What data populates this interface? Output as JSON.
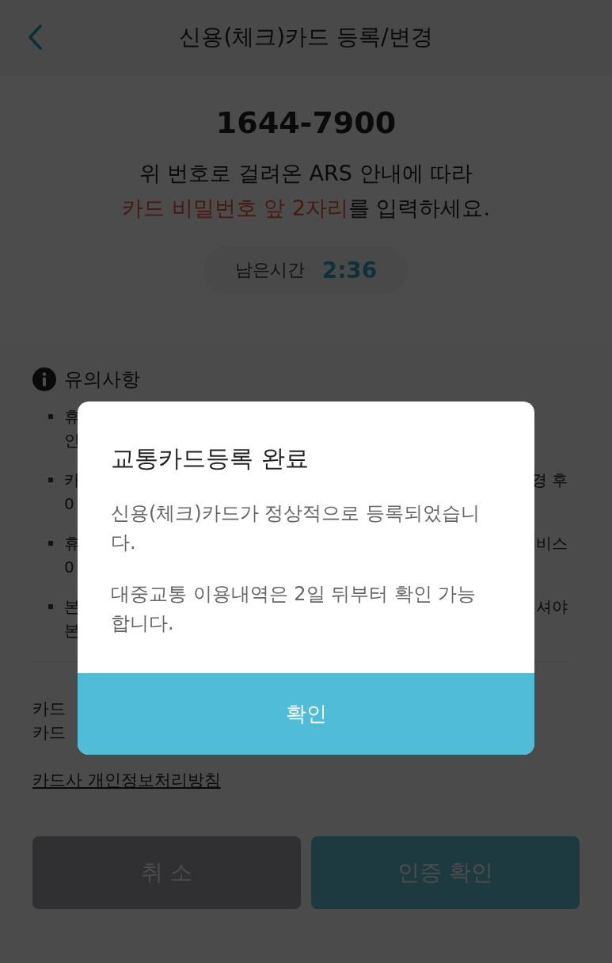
{
  "header": {
    "title": "신용(체크)카드 등록/변경"
  },
  "ars": {
    "phone": "1644-7900",
    "line_1": "위 번호로 걸려온 ARS 안내에 따라",
    "line_2": "**카드 비밀번호 앞 2자리**를 입력하세요.",
    "timer_label": "남은시간",
    "timer_value": "2:36"
  },
  "notes": {
    "heading": "유의사항",
    "items": [
      {
        "lines": [
          {
            "start": "휴"
          },
          {
            "start": "인"
          }
        ]
      },
      {
        "lines": [
          {
            "start": "카",
            "end": "경 후"
          },
          {
            "start": "0"
          }
        ]
      },
      {
        "lines": [
          {
            "start": "휴",
            "end": "비스"
          },
          {
            "start": "0"
          }
        ]
      },
      {
        "lines": [
          {
            "start": "본",
            "end": "셔야"
          },
          {
            "start": "본"
          }
        ]
      }
    ]
  },
  "card_info": {
    "lines": [
      "카드",
      "카드"
    ],
    "link": "카드사 개인정보처리방침"
  },
  "buttons": {
    "cancel": "취 소",
    "confirm": "인증 확인"
  },
  "dialog": {
    "title": "교통카드등록 완료",
    "paragraphs": [
      "신용(체크)카드가 정상적으로 등록되었습니다.",
      "대중교통 이용내역은 2일 뒤부터 확인 가능합니다."
    ],
    "button": "확인"
  }
}
